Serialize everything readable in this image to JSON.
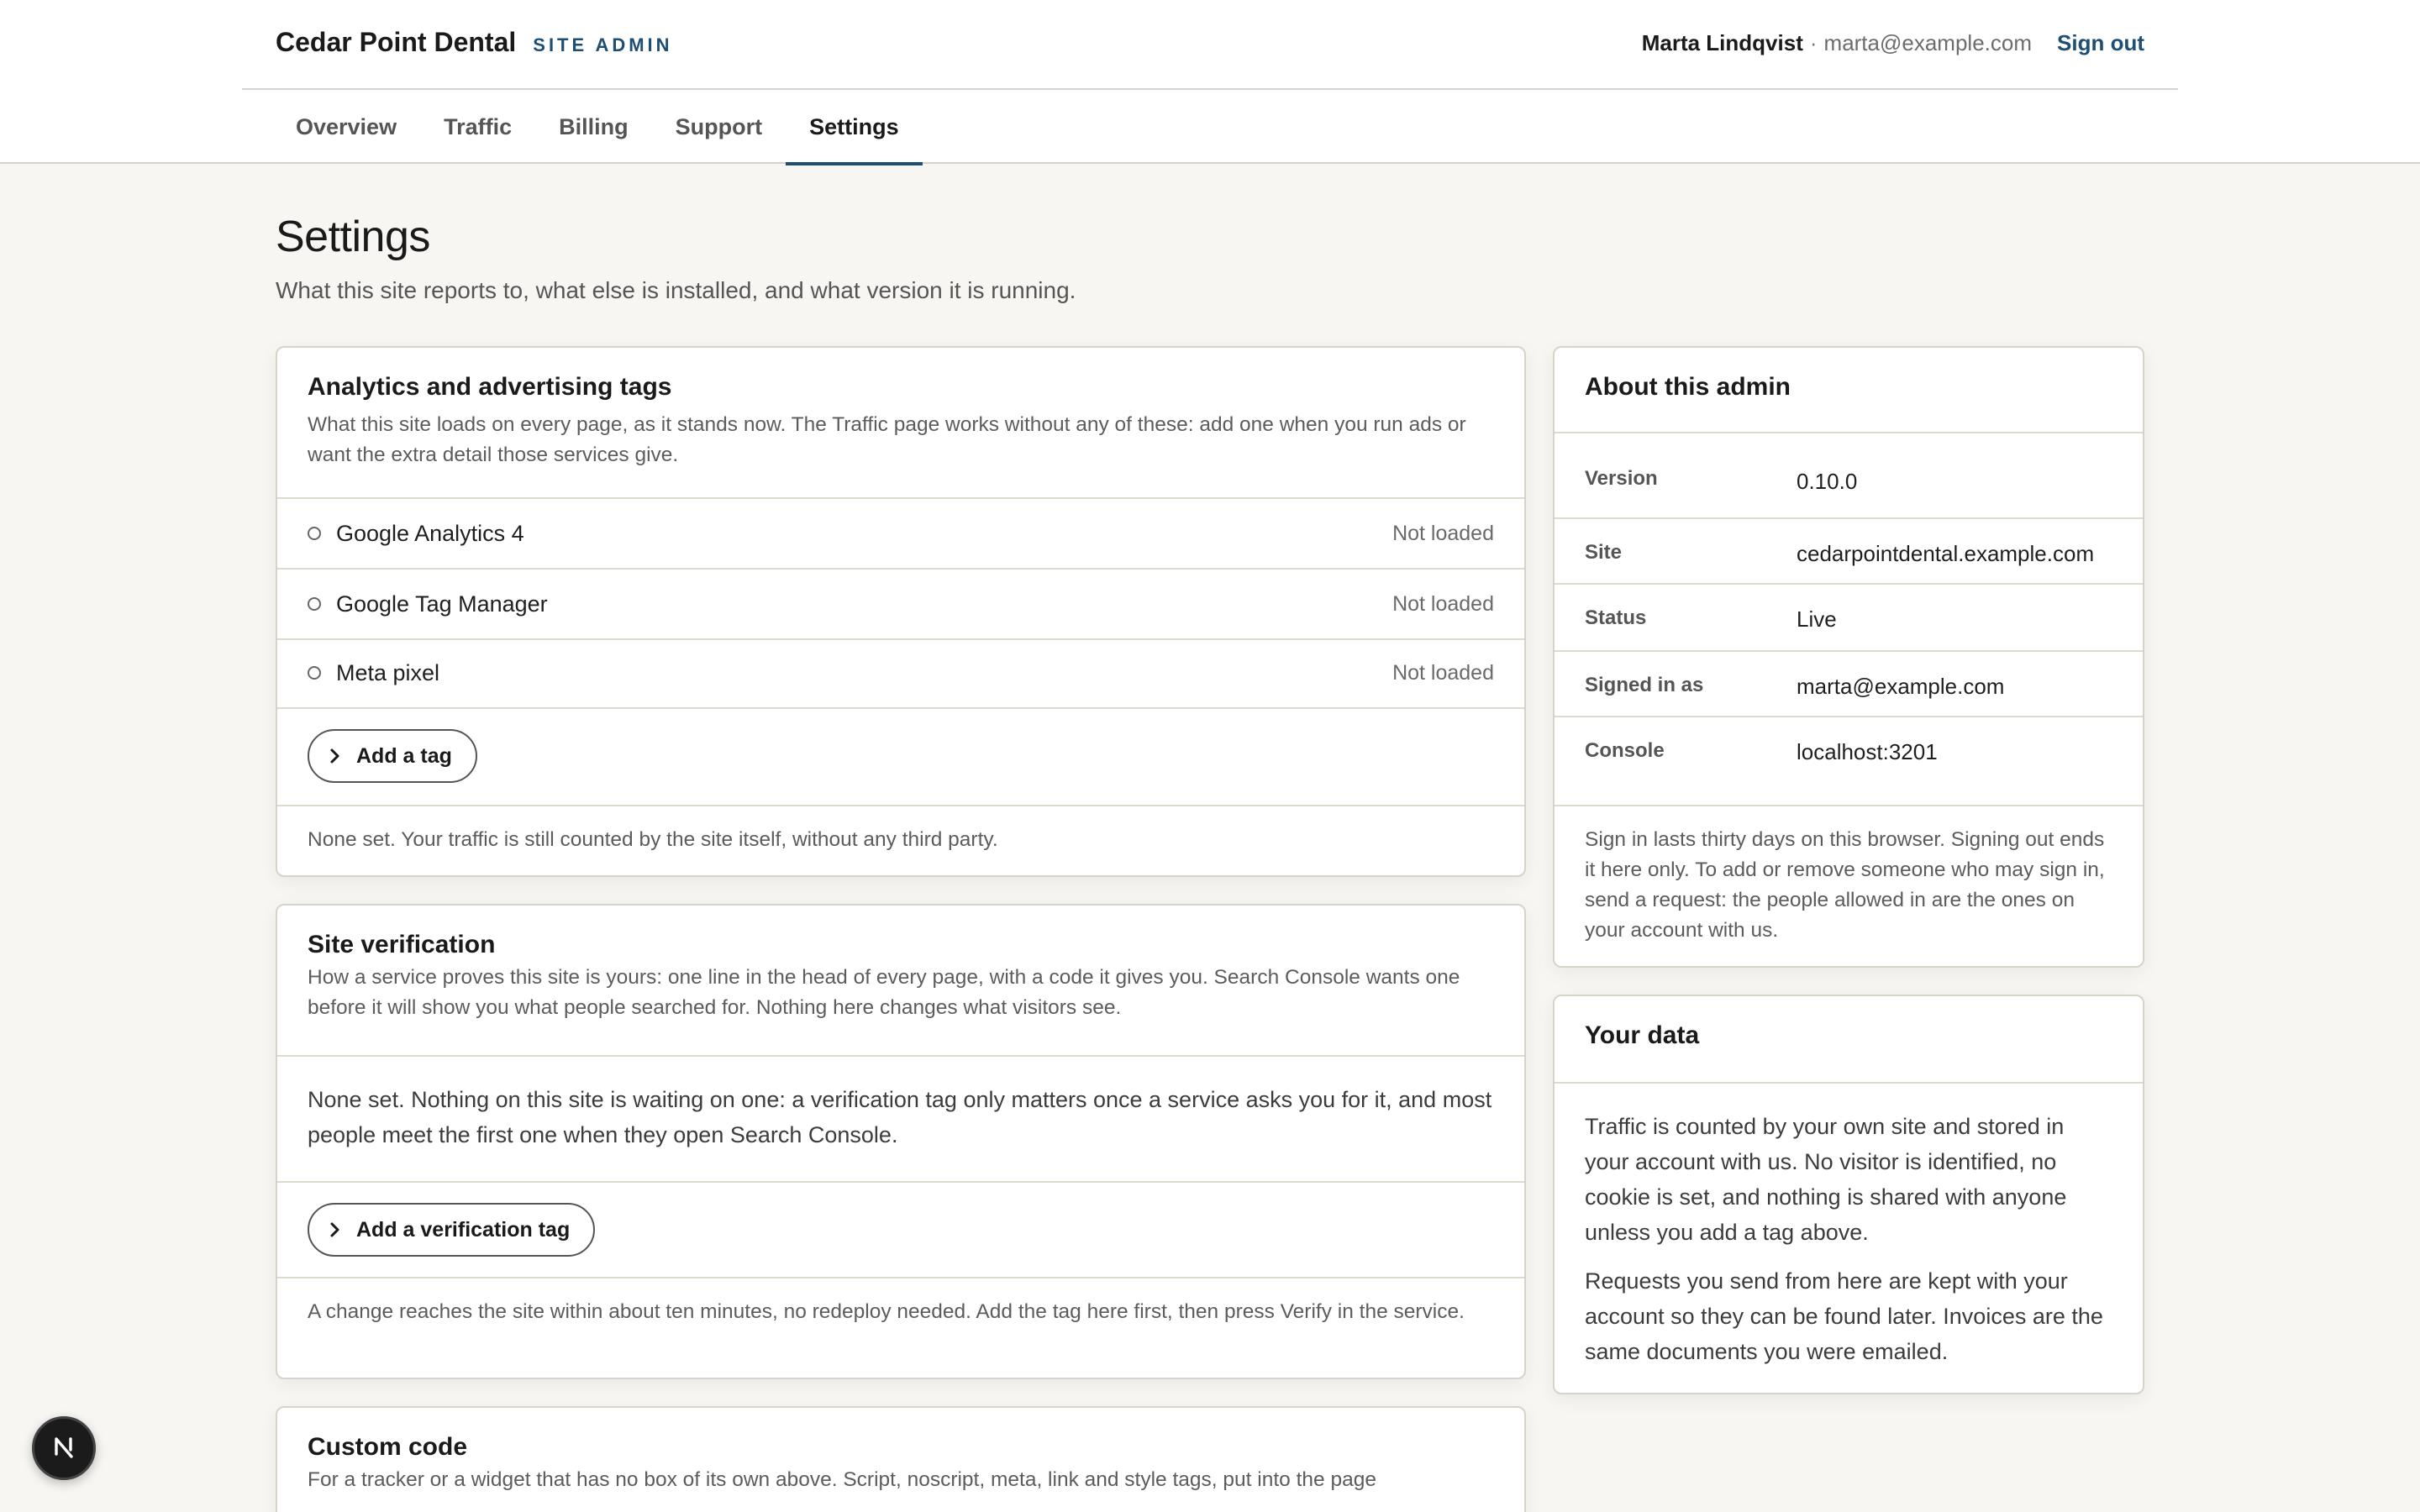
{
  "header": {
    "brand_name": "Cedar Point Dental",
    "brand_tag": "SITE ADMIN",
    "user_name": "Marta Lindqvist",
    "user_separator": "·",
    "user_email": "marta@example.com",
    "sign_out": "Sign out"
  },
  "tabs": [
    {
      "label": "Overview",
      "active": false
    },
    {
      "label": "Traffic",
      "active": false
    },
    {
      "label": "Billing",
      "active": false
    },
    {
      "label": "Support",
      "active": false
    },
    {
      "label": "Settings",
      "active": true
    }
  ],
  "page": {
    "title": "Settings",
    "subtitle": "What this site reports to, what else is installed, and what version it is running."
  },
  "analytics": {
    "title": "Analytics and advertising tags",
    "description": "What this site loads on every page, as it stands now. The Traffic page works without any of these: add one when you run ads or want the extra detail those services give.",
    "tags": [
      {
        "name": "Google Analytics 4",
        "status": "Not loaded"
      },
      {
        "name": "Google Tag Manager",
        "status": "Not loaded"
      },
      {
        "name": "Meta pixel",
        "status": "Not loaded"
      }
    ],
    "add_button": "Add a tag",
    "footer": "None set. Your traffic is still counted by the site itself, without any third party."
  },
  "verification": {
    "title": "Site verification",
    "description": "How a service proves this site is yours: one line in the head of every page, with a code it gives you. Search Console wants one before it will show you what people searched for. Nothing here changes what visitors see.",
    "body": "None set. Nothing on this site is waiting on one: a verification tag only matters once a service asks you for it, and most people meet the first one when they open Search Console.",
    "add_button": "Add a verification tag",
    "footer": "A change reaches the site within about ten minutes, no redeploy needed. Add the tag here first, then press Verify in the service."
  },
  "custom_code": {
    "title": "Custom code",
    "description": "For a tracker or a widget that has no box of its own above. Script, noscript, meta, link and style tags, put into the page"
  },
  "about": {
    "title": "About this admin",
    "rows": [
      {
        "label": "Version",
        "value": "0.10.0"
      },
      {
        "label": "Site",
        "value": "cedarpointdental.example.com"
      },
      {
        "label": "Status",
        "value": "Live"
      },
      {
        "label": "Signed in as",
        "value": "marta@example.com"
      },
      {
        "label": "Console",
        "value": "localhost:3201"
      }
    ],
    "note": "Sign in lasts thirty days on this browser. Signing out ends it here only. To add or remove someone who may sign in, send a request: the people allowed in are the ones on your account with us."
  },
  "your_data": {
    "title": "Your data",
    "para1": "Traffic is counted by your own site and stored in your account with us. No visitor is identified, no cookie is set, and nothing is shared with anyone unless you add a tag above.",
    "para2": "Requests you send from here are kept with your account so they can be found later. Invoices are the same documents you were emailed."
  },
  "badge": {
    "letter": "N",
    "icon": "nextjs-icon"
  },
  "colors": {
    "accent": "#1d4e73",
    "background": "#f7f6f2",
    "card": "#ffffff",
    "border": "#d6d3cb"
  }
}
